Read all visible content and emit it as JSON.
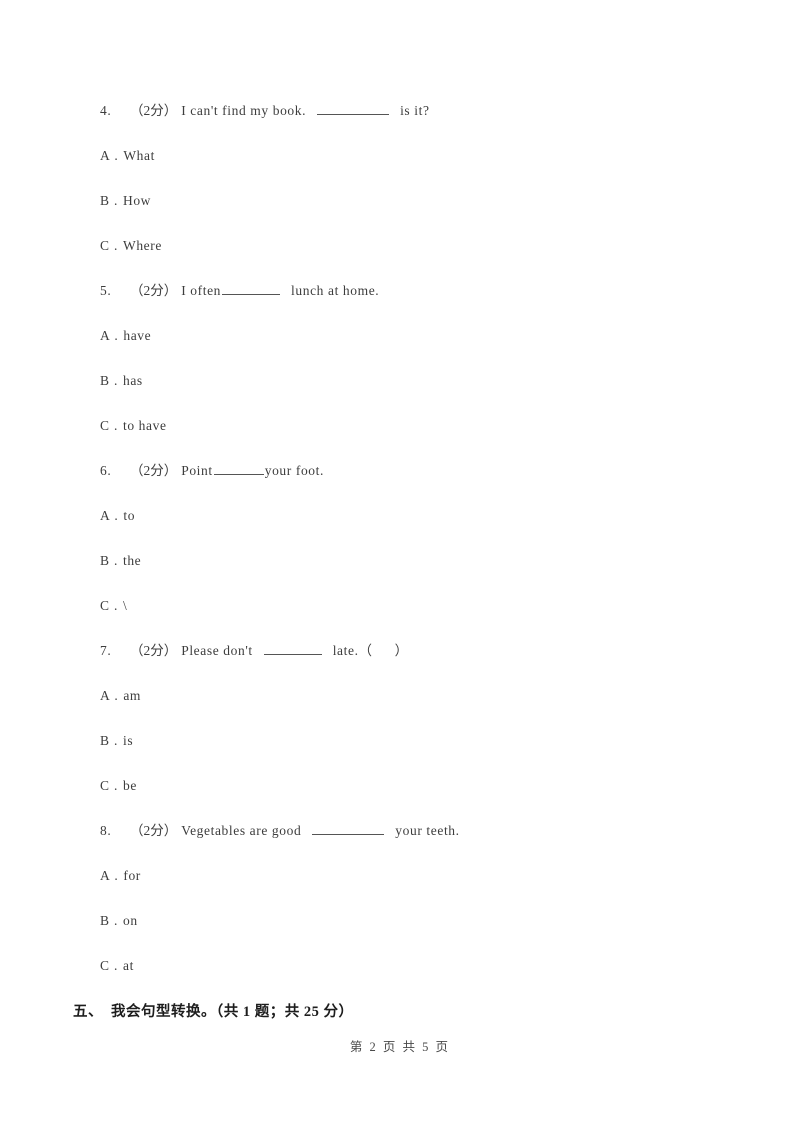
{
  "document": {
    "type": "exam-worksheet",
    "language_note": "Chinese English-exam page"
  },
  "questions": [
    {
      "number": "4.",
      "marks": "（2分）",
      "stem_before": "I can't find my book.",
      "blank": "long",
      "stem_after": "is it?",
      "options": [
        {
          "letter": "A",
          "dot": ".",
          "text": "What"
        },
        {
          "letter": "B",
          "dot": ".",
          "text": "How"
        },
        {
          "letter": "C",
          "dot": ".",
          "text": "Where"
        }
      ]
    },
    {
      "number": "5.",
      "marks": "（2分）",
      "stem_before": "I often",
      "blank": "mid",
      "stem_after": "lunch at home.",
      "options": [
        {
          "letter": "A",
          "dot": ".",
          "text": "have"
        },
        {
          "letter": "B",
          "dot": ".",
          "text": "has"
        },
        {
          "letter": "C",
          "dot": ".",
          "text": "to have"
        }
      ]
    },
    {
      "number": "6.",
      "marks": "（2分）",
      "stem_before": "Point",
      "blank": "short",
      "stem_after": "your foot.",
      "options": [
        {
          "letter": "A",
          "dot": ".",
          "text": "to"
        },
        {
          "letter": "B",
          "dot": ".",
          "text": "the"
        },
        {
          "letter": "C",
          "dot": ".",
          "text": "\\"
        }
      ]
    },
    {
      "number": "7.",
      "marks": "（2分）",
      "stem_before": "Please don't",
      "blank": "mid",
      "stem_after": "late.（",
      "stem_tail": "）",
      "options": [
        {
          "letter": "A",
          "dot": ".",
          "text": "am"
        },
        {
          "letter": "B",
          "dot": ".",
          "text": "is"
        },
        {
          "letter": "C",
          "dot": ".",
          "text": "be"
        }
      ]
    },
    {
      "number": "8.",
      "marks": "（2分）",
      "stem_before": "Vegetables are good",
      "blank": "long",
      "stem_after": "your teeth.",
      "options": [
        {
          "letter": "A",
          "dot": ".",
          "text": "for"
        },
        {
          "letter": "B",
          "dot": ".",
          "text": "on"
        },
        {
          "letter": "C",
          "dot": ".",
          "text": "at"
        }
      ]
    }
  ],
  "section_heading": {
    "label": "五、",
    "title": "我会句型转换。（共 1 题；共 25 分）"
  },
  "footer": {
    "text": "第 2 页 共 5 页"
  }
}
